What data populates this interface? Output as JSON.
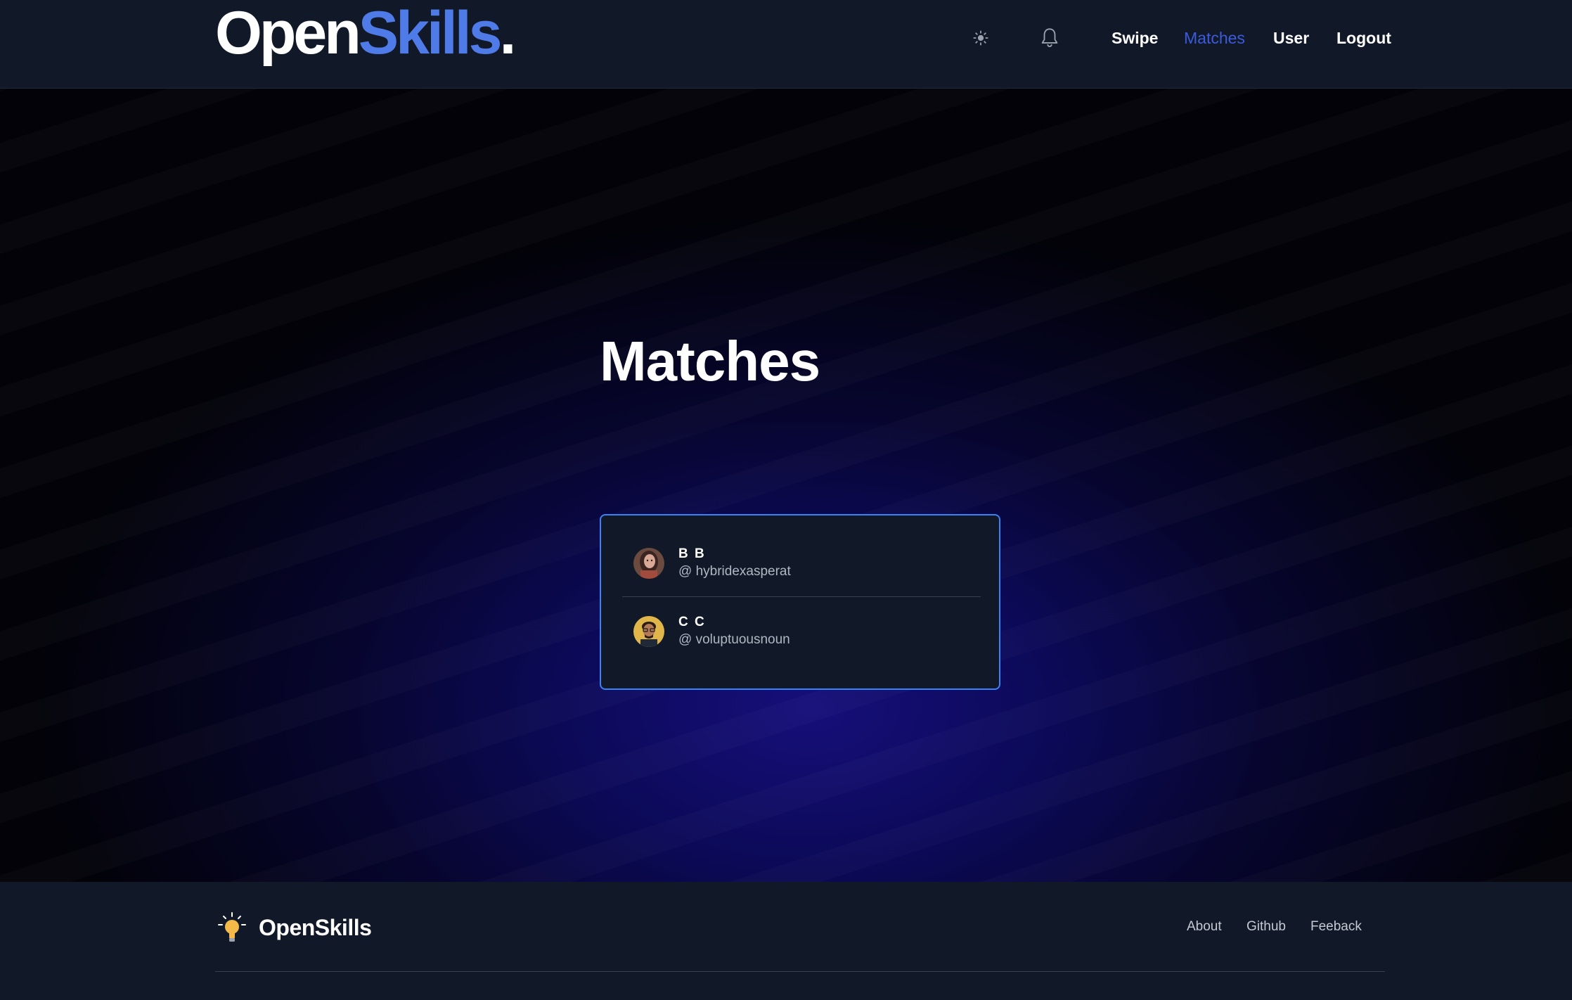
{
  "header": {
    "logo": {
      "part1": "Open",
      "part2": "Skills",
      "part3": "."
    },
    "theme_icon": "sun-icon",
    "notification_icon": "bell-icon",
    "nav": [
      {
        "label": "Swipe",
        "active": false
      },
      {
        "label": "Matches",
        "active": true
      },
      {
        "label": "User",
        "active": false
      },
      {
        "label": "Logout",
        "active": false
      }
    ]
  },
  "main": {
    "title": "Matches",
    "matches": [
      {
        "name": "B B",
        "handle": "@ hybridexasperat",
        "avatar": "avatar-woman"
      },
      {
        "name": "C C",
        "handle": "@ voluptuousnoun",
        "avatar": "avatar-man"
      }
    ]
  },
  "footer": {
    "brand": "OpenSkills",
    "brand_icon": "lightbulb-icon",
    "links": [
      "About",
      "Github",
      "Feeback"
    ]
  },
  "colors": {
    "accent": "#4f7be8",
    "active_nav": "#3b5bdb",
    "card_border": "#3b82f6",
    "surface": "#111827"
  }
}
